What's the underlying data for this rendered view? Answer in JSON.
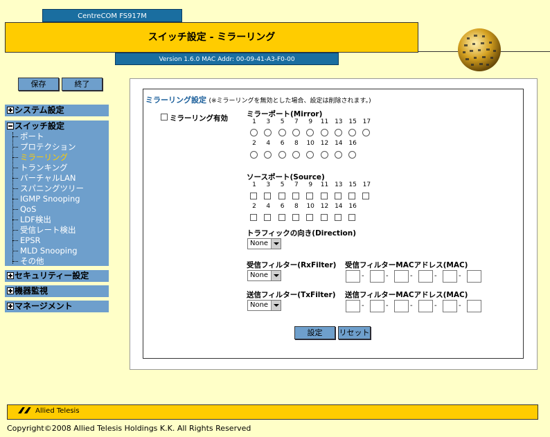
{
  "header": {
    "model": "CentreCOM FS917M",
    "title": "スイッチ設定 - ミラーリング",
    "version": "Version 1.6.0 MAC Addr: 00-09-41-A3-F0-00"
  },
  "sidebar": {
    "save_label": "保存",
    "exit_label": "終了",
    "system": "システム設定",
    "switch": "スイッチ設定",
    "switch_items": [
      "ポート",
      "プロテクション",
      "ミラーリング",
      "トランキング",
      "バーチャルLAN",
      "スパニングツリー",
      "IGMP Snooping",
      "QoS",
      "LDF検出",
      "受信レート検出",
      "EPSR",
      "MLD Snooping",
      "その他"
    ],
    "active_item": "ミラーリング",
    "security": "セキュリティー設定",
    "monitoring": "機器監視",
    "management": "マネージメント"
  },
  "main": {
    "section_title": "ミラーリング設定",
    "section_note": "(※ミラーリングを無効とした場合、設定は削除されます。)",
    "enable_label": "ミラーリング有効",
    "mirror_label": "ミラーポート(Mirror)",
    "source_label": "ソースポート(Source)",
    "ports_odd": [
      "1",
      "3",
      "5",
      "7",
      "9",
      "11",
      "13",
      "15",
      "17"
    ],
    "ports_even": [
      "2",
      "4",
      "6",
      "8",
      "10",
      "12",
      "14",
      "16"
    ],
    "direction_label": "トラフィックの向き(Direction)",
    "direction_value": "None",
    "rxfilter_label": "受信フィルター(RxFilter)",
    "rxfilter_value": "None",
    "rxmac_label": "受信フィルターMACアドレス(MAC)",
    "txfilter_label": "送信フィルター(TxFilter)",
    "txfilter_value": "None",
    "txmac_label": "送信フィルターMACアドレス(MAC)",
    "apply_label": "設定",
    "reset_label": "リセット"
  },
  "footer": {
    "logo": "Allied Telesis",
    "copyright": "Copyright©2008 Allied Telesis Holdings K.K. All Rights Reserved"
  },
  "colors": {
    "accent": "#ffcc00",
    "nav": "#6e9fcc",
    "header_blue": "#1a6ea0",
    "background": "#ffffc8"
  }
}
